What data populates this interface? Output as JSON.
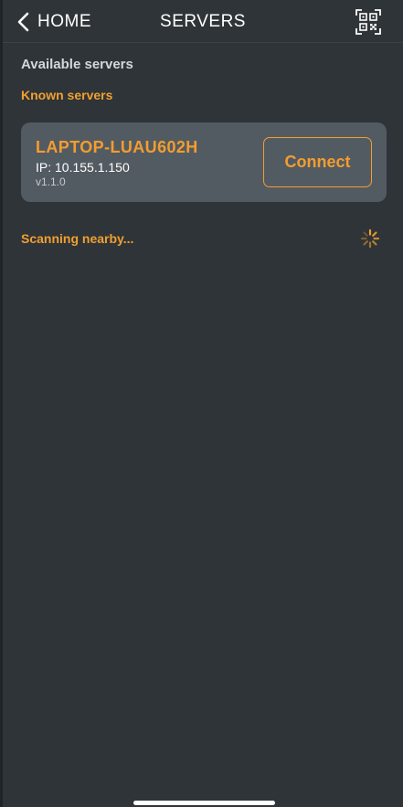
{
  "header": {
    "back_label": "HOME",
    "title": "SERVERS",
    "qr_icon": "qr-code-scan-icon"
  },
  "sections": {
    "available_title": "Available servers",
    "known_title": "Known servers"
  },
  "known_servers": [
    {
      "name": "LAPTOP-LUAU602H",
      "ip": "IP: 10.155.1.150",
      "version": "v1.1.0",
      "action_label": "Connect"
    }
  ],
  "scan": {
    "status": "Scanning nearby...",
    "spinner_icon": "loading-spinner-icon"
  },
  "colors": {
    "background": "#2f3438",
    "card": "#535b62",
    "accent": "#f39d2f",
    "text": "#ffffff"
  }
}
